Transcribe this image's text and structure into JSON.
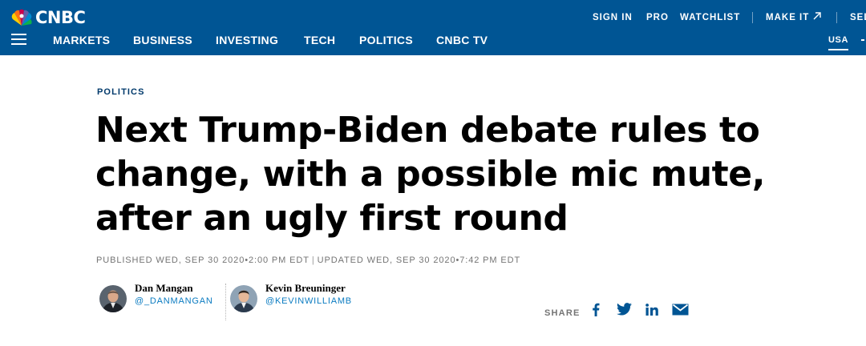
{
  "brand": {
    "logo_text": "CNBC",
    "colors": {
      "header_bg": "#005594",
      "link_blue": "#0a7bc1",
      "eyebrow": "#00396b",
      "meta_gray": "#747474"
    }
  },
  "utility_nav": {
    "sign_in": "SIGN IN",
    "pro": "PRO",
    "watchlist": "WATCHLIST",
    "make_it": "MAKE IT",
    "make_it_icon": "external-arrow-icon",
    "select": "SEL"
  },
  "main_nav": {
    "menu_icon": "hamburger-icon",
    "items": [
      "MARKETS",
      "BUSINESS",
      "INVESTING",
      "TECH",
      "POLITICS",
      "CNBC TV"
    ],
    "region": "USA"
  },
  "article": {
    "eyebrow": "POLITICS",
    "headline": "Next Trump-Biden debate rules to change, with a possible mic mute, after an ugly first round",
    "published": "PUBLISHED WED, SEP 30 2020•2:00 PM EDT",
    "separator": "|",
    "updated": "UPDATED WED, SEP 30 2020•7:42 PM EDT",
    "authors": [
      {
        "name": "Dan Mangan",
        "handle": "@_DANMANGAN"
      },
      {
        "name": "Kevin Breuninger",
        "handle": "@KEVINWILLIAMB"
      }
    ]
  },
  "share": {
    "label": "SHARE",
    "icons": [
      "facebook-icon",
      "twitter-icon",
      "linkedin-icon",
      "email-icon"
    ]
  }
}
